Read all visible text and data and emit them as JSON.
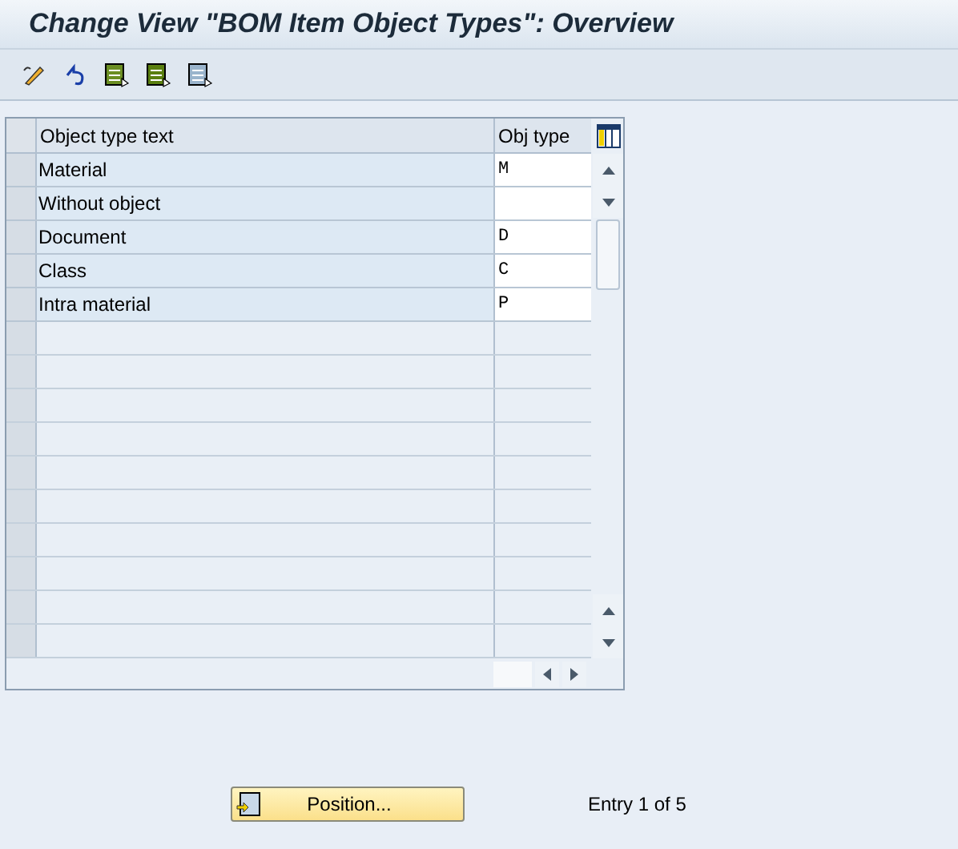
{
  "window": {
    "title": "Change View \"BOM Item Object Types\": Overview"
  },
  "table": {
    "columns": [
      "Object type text",
      "Obj type"
    ],
    "rows": [
      {
        "text": "Material",
        "obj_type": "M"
      },
      {
        "text": "Without object",
        "obj_type": ""
      },
      {
        "text": "Document",
        "obj_type": "D"
      },
      {
        "text": "Class",
        "obj_type": "C"
      },
      {
        "text": "Intra material",
        "obj_type": "P"
      }
    ]
  },
  "footer": {
    "position_button": "Position...",
    "entry_info": "Entry 1 of 5"
  }
}
